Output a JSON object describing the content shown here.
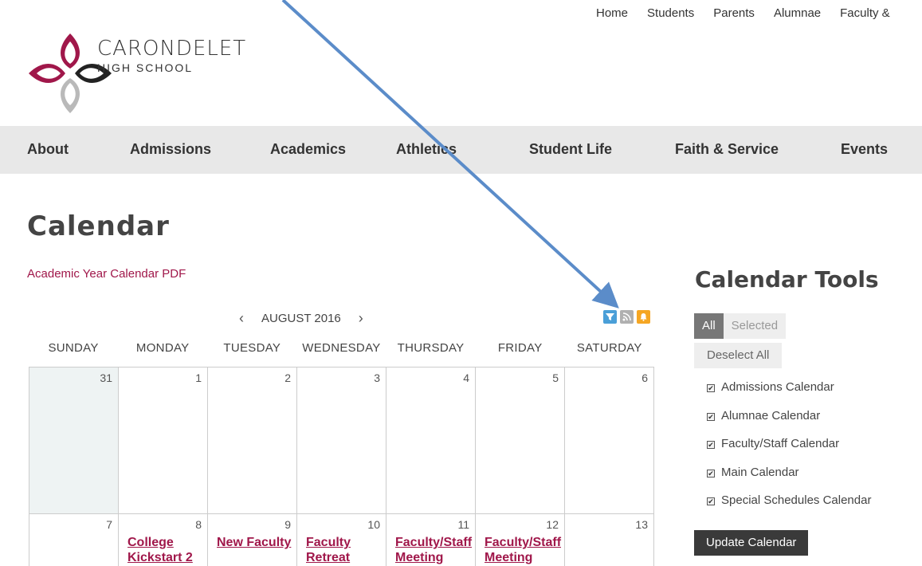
{
  "top_nav": [
    "Home",
    "Students",
    "Parents",
    "Alumnae",
    "Faculty &"
  ],
  "logo": {
    "name": "CARONDELET",
    "sub": "HIGH SCHOOL"
  },
  "main_nav": [
    "About",
    "Admissions",
    "Academics",
    "Athletics",
    "Student Life",
    "Faith & Service",
    "Events"
  ],
  "page": {
    "title": "Calendar",
    "pdf_link": "Academic Year Calendar PDF"
  },
  "calendar": {
    "month": "AUGUST 2016",
    "prev": "‹",
    "next": "›",
    "icons": [
      "filter-icon",
      "rss-icon",
      "bell-icon"
    ],
    "day_names": [
      "SUNDAY",
      "MONDAY",
      "TUESDAY",
      "WEDNESDAY",
      "THURSDAY",
      "FRIDAY",
      "SATURDAY"
    ],
    "weeks": [
      [
        {
          "day": "31",
          "event": ""
        },
        {
          "day": "1",
          "event": ""
        },
        {
          "day": "2",
          "event": ""
        },
        {
          "day": "3",
          "event": ""
        },
        {
          "day": "4",
          "event": ""
        },
        {
          "day": "5",
          "event": ""
        },
        {
          "day": "6",
          "event": ""
        }
      ],
      [
        {
          "day": "7",
          "event": ""
        },
        {
          "day": "8",
          "event": "College Kickstart 2"
        },
        {
          "day": "9",
          "event": "New Faculty"
        },
        {
          "day": "10",
          "event": "Faculty Retreat"
        },
        {
          "day": "11",
          "event": "Faculty/Staff Meeting"
        },
        {
          "day": "12",
          "event": "Faculty/Staff Meeting"
        },
        {
          "day": "13",
          "event": ""
        }
      ]
    ]
  },
  "sidebar": {
    "title": "Calendar Tools",
    "seg_all": "All",
    "seg_selected": "Selected",
    "deselect": "Deselect All",
    "calendars": [
      "Admissions Calendar",
      "Alumnae Calendar",
      "Faculty/Staff Calendar",
      "Main Calendar",
      "Special Schedules Calendar"
    ],
    "update": "Update Calendar"
  },
  "colors": {
    "accent": "#a0174a",
    "nav_bg": "#e8e8e8",
    "filter_icon": "#4a9fd8",
    "rss_icon": "#b0b0b0",
    "bell_icon": "#f5a623",
    "arrow": "#5b8cc9"
  }
}
